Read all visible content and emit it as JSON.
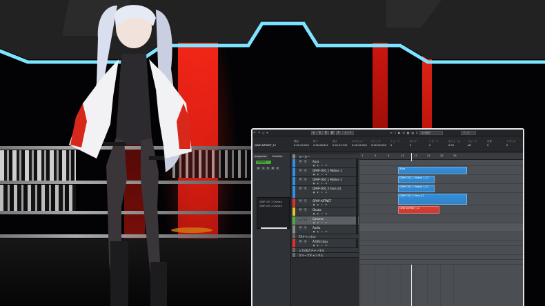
{
  "toolbar": {
    "tool_modes": [
      "⌖",
      "S",
      "R",
      "W",
      "A"
    ],
    "touch_mode": "タッチ",
    "box_labels": [
      "4分音符",
      "ソフト",
      "1/16 bars"
    ],
    "presets": [
      "プロジェクト",
      "エフェクト",
      "配置"
    ],
    "misc_icons": [
      "↶",
      "↷",
      "◇",
      "⌖",
      "↔",
      "♪",
      "▶",
      "⊡",
      "▦",
      "▤",
      "⌗"
    ]
  },
  "infoline": {
    "project_title": "QPAP-ARTNET_12",
    "fields": [
      {
        "header": "開始",
        "value": "0:00:00.000"
      },
      {
        "header": "終了",
        "value": "0:00:08.841"
      },
      {
        "header": "長さ",
        "value": "0:01:07.391"
      },
      {
        "header": "オフセット",
        "value": "0:00:00.000"
      },
      {
        "header": "スナップ",
        "value": "0:00:00.000"
      },
      {
        "header": "ミュート",
        "value": "0"
      },
      {
        "header": "ロック",
        "value": "0"
      },
      {
        "header": "リピート",
        "value": "0"
      },
      {
        "header": "ボリューム",
        "value": "0.00"
      },
      {
        "header": "フェード",
        "value": "dB"
      },
      {
        "header": "位置",
        "value": "0"
      },
      {
        "header": "トランス",
        "value": "0"
      }
    ]
  },
  "inspector": {
    "tabs": [
      "Inspector",
      "Visibility"
    ],
    "header_label": "Camera",
    "buttons": [
      "M",
      "S",
      "R",
      "W",
      "E"
    ],
    "items": [
      "QPAP-OSC 2 Camera",
      "QPAP-OSC 4 Camera"
    ]
  },
  "tracks": [
    {
      "name": "マーカー",
      "color": "#8a8a8a",
      "buttons": [],
      "selected": false
    },
    {
      "name": "Aura",
      "color": "#2e90e8",
      "buttons": [
        "M",
        "S"
      ],
      "selected": false
    },
    {
      "name": "QPAP-OSC 1 Motion 1",
      "color": "#2e90e8",
      "buttons": [
        "M",
        "S"
      ],
      "selected": false
    },
    {
      "name": "QPAP-OSC 1 Motion 2",
      "color": "#2e90e8",
      "buttons": [
        "M",
        "S"
      ],
      "selected": false
    },
    {
      "name": "QPAP-OSC 2 Face_01",
      "color": "#2e90e8",
      "buttons": [
        "M",
        "S"
      ],
      "selected": false
    },
    {
      "name": "QPAP-ARTNET",
      "color": "#e0302a",
      "buttons": [
        "M",
        "S"
      ],
      "selected": false
    },
    {
      "name": "Okuka",
      "color": "#e8c22a",
      "buttons": [
        "M",
        "S"
      ],
      "selected": false
    },
    {
      "name": "Camera",
      "color": "#4aa93c",
      "buttons": [
        "M",
        "S"
      ],
      "selected": true
    },
    {
      "name": "Audio",
      "color": "#8a8a8a",
      "buttons": [
        "M",
        "S"
      ],
      "selected": false
    },
    {
      "name": "FXチャンネル",
      "color": "#6a6a6a",
      "buttons": [],
      "selected": false
    },
    {
      "name": "Artifist bau",
      "color": "#e0302a",
      "buttons": [
        "M",
        "S"
      ],
      "selected": false
    },
    {
      "name": "入力/出力チャンネル",
      "color": "#6a6a6a",
      "buttons": [],
      "selected": false
    },
    {
      "name": "グループチャンネル",
      "color": "#6a6a6a",
      "buttons": [],
      "selected": false
    }
  ],
  "ruler": {
    "labels": [
      "1",
      "5",
      "9",
      "13",
      "17",
      "21",
      "25",
      "29"
    ]
  },
  "clips": [
    {
      "lane": 1,
      "label": "Aura",
      "color": "#2f8fdf",
      "start": 9,
      "length": 15
    },
    {
      "lane": 2,
      "label": "QPAP-OSC 1 Motion 1_01",
      "color": "#2f8fdf",
      "start": 9,
      "length": 8
    },
    {
      "lane": 3,
      "label": "QPAP-OSC 1 Motion 2_01",
      "color": "#2f8fdf",
      "start": 9,
      "length": 8
    },
    {
      "lane": 4,
      "label": "QPAP-OSC 2 Face_01",
      "color": "#2f8fdf",
      "start": 9,
      "length": 15
    },
    {
      "lane": 5,
      "label": "QPAP-ARTNET_12",
      "color": "#e23a2f",
      "start": 9,
      "length": 9
    }
  ]
}
